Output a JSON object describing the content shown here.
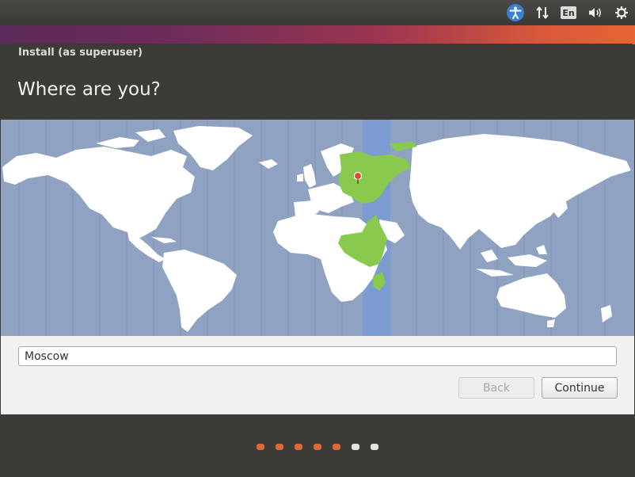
{
  "window": {
    "title": "Install (as superuser)"
  },
  "page": {
    "heading": "Where are you?"
  },
  "tray": {
    "icons": [
      "accessibility-icon",
      "network-icon",
      "keyboard-layout-icon",
      "volume-icon",
      "power-settings-icon"
    ],
    "keyboard_layout": "En"
  },
  "map": {
    "selected_city": "Moscow",
    "timezone_band_color": "#7b9bd1",
    "highlight_color": "#88c94e",
    "land_color": "#ffffff",
    "sea_color": "#8fa2c2",
    "pin_color": "#e1463b"
  },
  "location": {
    "value": "Moscow"
  },
  "buttons": {
    "back": "Back",
    "continue": "Continue"
  },
  "progress": {
    "total_steps": 7,
    "completed_steps": 5,
    "active_color": "#dd6938",
    "inactive_color": "#e4e3e0"
  }
}
